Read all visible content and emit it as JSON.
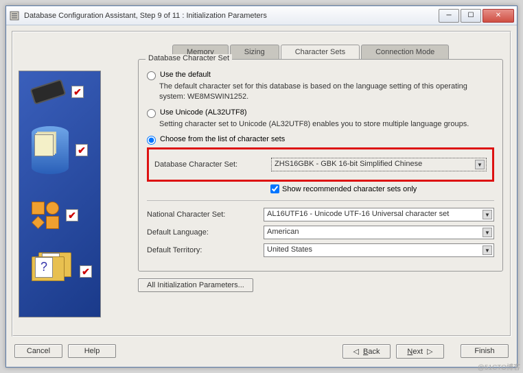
{
  "window": {
    "title": "Database Configuration Assistant, Step 9 of 11 : Initialization Parameters"
  },
  "tabs": {
    "memory": "Memory",
    "sizing": "Sizing",
    "charsets": "Character Sets",
    "connmode": "Connection Mode"
  },
  "fieldset": {
    "legend": "Database Character Set",
    "opt1": {
      "label": "Use the default",
      "desc": "The default character set for this database is based on the language setting of this operating system: WE8MSWIN1252."
    },
    "opt2": {
      "label": "Use Unicode (AL32UTF8)",
      "desc": "Setting character set to Unicode (AL32UTF8) enables you to store multiple language groups."
    },
    "opt3": {
      "label": "Choose from the list of character sets"
    },
    "db_charset_label": "Database Character Set:",
    "db_charset_value": "ZHS16GBK - GBK 16-bit Simplified Chinese",
    "show_recommended": "Show recommended character sets only"
  },
  "national": {
    "label": "National Character Set:",
    "value": "AL16UTF16 - Unicode UTF-16 Universal character set"
  },
  "language": {
    "label": "Default Language:",
    "value": "American"
  },
  "territory": {
    "label": "Default Territory:",
    "value": "United States"
  },
  "all_params_btn": "All Initialization Parameters...",
  "buttons": {
    "cancel": "Cancel",
    "help": "Help",
    "back": "Back",
    "next": "Next",
    "finish": "Finish"
  },
  "watermark": "@51CTO博客"
}
